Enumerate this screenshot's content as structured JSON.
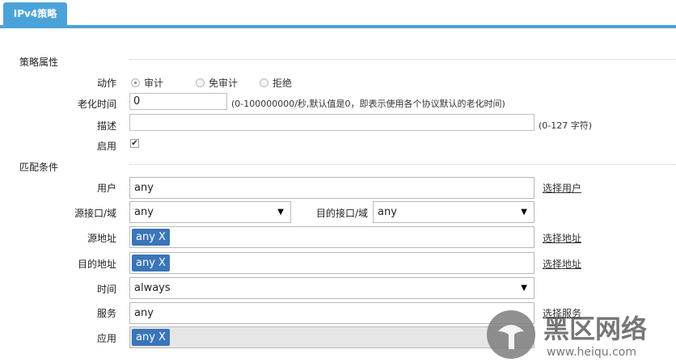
{
  "tab": {
    "label": "IPv4策略"
  },
  "sections": {
    "props": "策略属性",
    "match": "匹配条件"
  },
  "action": {
    "label": "动作",
    "options": [
      "审计",
      "免审计",
      "拒绝"
    ],
    "selected": "审计"
  },
  "aging": {
    "label": "老化时间",
    "value": "0",
    "hint": "(0-100000000/秒,默认值是0，即表示使用各个协议默认的老化时间)"
  },
  "desc": {
    "label": "描述",
    "value": "",
    "hint": "(0-127 字符)"
  },
  "enable": {
    "label": "启用",
    "checked": true
  },
  "user": {
    "label": "用户",
    "value": "any",
    "link": "选择用户"
  },
  "src_if": {
    "label": "源接口/域",
    "value": "any"
  },
  "dst_if": {
    "label": "目的接口/域",
    "value": "any"
  },
  "src_addr": {
    "label": "源地址",
    "tag": "any X",
    "link": "选择地址"
  },
  "dst_addr": {
    "label": "目的地址",
    "tag": "any X",
    "link": "选择地址"
  },
  "time": {
    "label": "时间",
    "value": "always"
  },
  "service": {
    "label": "服务",
    "value": "any",
    "link": "选择服务"
  },
  "app": {
    "label": "应用",
    "tag": "any X"
  },
  "watermark": {
    "main": "黑区网络",
    "sub": "www.heiqu.com"
  }
}
